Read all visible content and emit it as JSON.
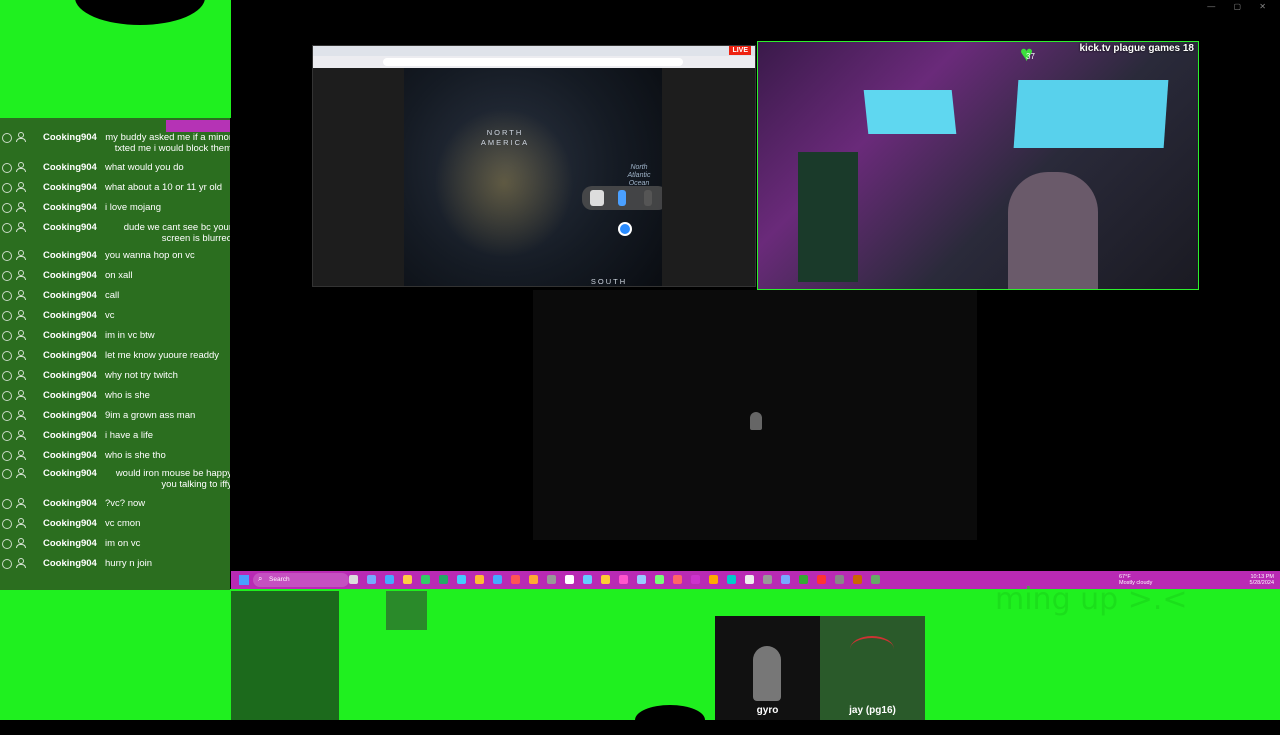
{
  "chat": {
    "messages": [
      {
        "user": "Cooking904",
        "text": "my buddy asked me if a minor txted me i would block them"
      },
      {
        "user": "Cooking904",
        "text": "what would you do"
      },
      {
        "user": "Cooking904",
        "text": "what about a 10 or 11 yr old"
      },
      {
        "user": "Cooking904",
        "text": "i love mojang"
      },
      {
        "user": "Cooking904",
        "text": "dude we cant see bc your screen is blurred"
      },
      {
        "user": "Cooking904",
        "text": "you wanna hop on vc"
      },
      {
        "user": "Cooking904",
        "text": "on xall"
      },
      {
        "user": "Cooking904",
        "text": "call"
      },
      {
        "user": "Cooking904",
        "text": "vc"
      },
      {
        "user": "Cooking904",
        "text": "im in vc btw"
      },
      {
        "user": "Cooking904",
        "text": "let me know yuoure readdy"
      },
      {
        "user": "Cooking904",
        "text": "why not try twitch"
      },
      {
        "user": "Cooking904",
        "text": "who is she"
      },
      {
        "user": "Cooking904",
        "text": "9im a grown ass man"
      },
      {
        "user": "Cooking904",
        "text": "i have a life"
      },
      {
        "user": "Cooking904",
        "text": "who is she tho"
      },
      {
        "user": "Cooking904",
        "text": "would iron mouse be happy you talking to iffy"
      },
      {
        "user": "Cooking904",
        "text": "?vc? now"
      },
      {
        "user": "Cooking904",
        "text": "vc cmon"
      },
      {
        "user": "Cooking904",
        "text": "im on vc"
      },
      {
        "user": "Cooking904",
        "text": "hurry n join"
      }
    ]
  },
  "browser": {
    "live_badge": "LIVE",
    "map": {
      "north_america": "NORTH AMERICA",
      "ocean": "North Atlantic Ocean",
      "south": "SOUTH"
    }
  },
  "webcam": {
    "overlay_title": "kick.tv plague games 18",
    "heart_count": "37"
  },
  "taskbar": {
    "search_placeholder": "Search",
    "weather_temp": "67°F",
    "weather_desc": "Mostly cloudy",
    "time": "10:13 PM",
    "date": "5/28/2024"
  },
  "ghost_text": "ming up >.<",
  "participants": [
    {
      "name": "gyro"
    },
    {
      "name": "jay (pg16)"
    }
  ],
  "colors": {
    "chroma_green": "#1ff01f",
    "chat_bg": "#2b6e1f",
    "taskbar": "#b92ab4"
  }
}
